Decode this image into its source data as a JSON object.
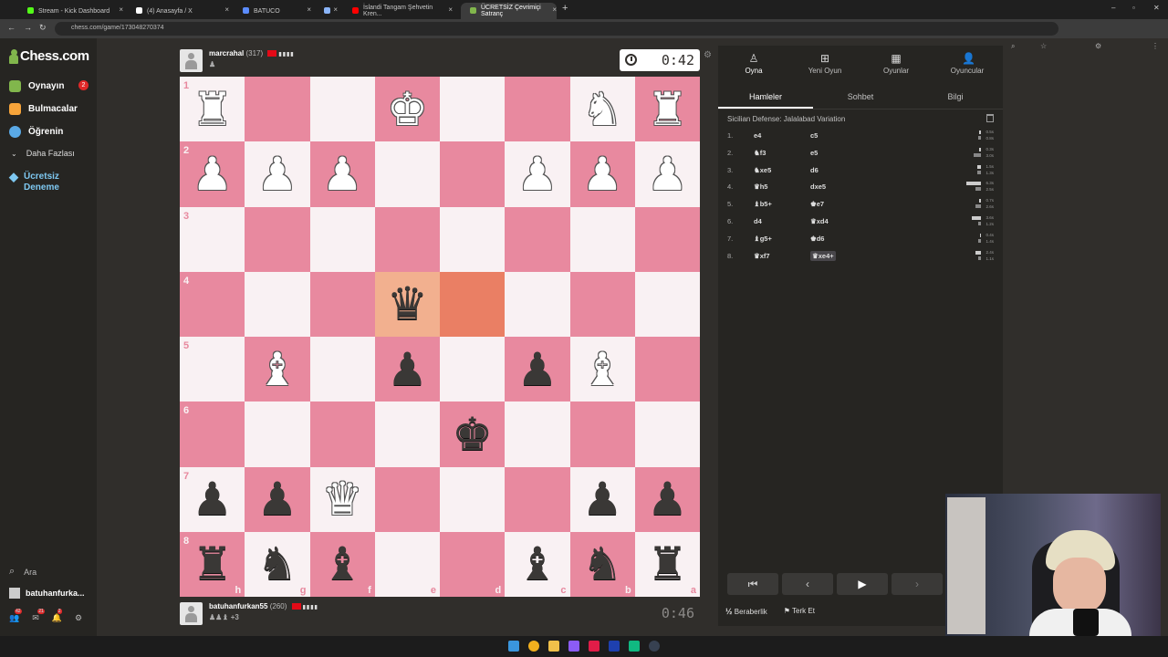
{
  "browser": {
    "tabs": [
      {
        "title": "Stream - Kick Dashboard",
        "fav": "#53fc18"
      },
      {
        "title": "(4) Anasayfa / X",
        "fav": "#ffffff"
      },
      {
        "title": "BATUCO",
        "fav": "#5b8cff"
      },
      {
        "title": "",
        "fav": "#8ab4f8"
      },
      {
        "title": "İslandi Tangam Şehvetin Kren...",
        "fav": "#ff0000"
      },
      {
        "title": "ÜCRETSİZ Çevrimiçi Satranç",
        "fav": "#81b64c"
      }
    ],
    "url": "chess.com/game/173048270374"
  },
  "sidebar": {
    "logo": "Chess.com",
    "items": [
      {
        "label": "Oynayın",
        "badge": "2",
        "color": "#81b64c"
      },
      {
        "label": "Bulmacalar",
        "color": "#f7a43a"
      },
      {
        "label": "Öğrenin",
        "color": "#5aa9e6"
      },
      {
        "label": "Daha Fazlası"
      }
    ],
    "trial": {
      "line1": "Ücretsiz",
      "line2": "Deneme"
    },
    "search": "Ara",
    "user": "batuhanfurka...",
    "notif_counts": [
      "42",
      "21",
      "2"
    ]
  },
  "top_player": {
    "name": "marcrahal",
    "rating": "(317)",
    "clock": "0:42"
  },
  "bottom_player": {
    "name": "batuhanfurkan55",
    "rating": "(260)",
    "clock": "0:46",
    "captured": "+3"
  },
  "board": {
    "ranks": [
      "1",
      "2",
      "3",
      "4",
      "5",
      "6",
      "7",
      "8"
    ],
    "files": [
      "h",
      "g",
      "f",
      "e",
      "d",
      "c",
      "b",
      "a"
    ],
    "rows": [
      [
        "wR",
        "",
        "",
        "wK",
        "",
        "",
        "wN",
        "wR"
      ],
      [
        "wP",
        "wP",
        "wP",
        "",
        "",
        "wP",
        "wP",
        "wP"
      ],
      [
        "",
        "",
        "",
        "",
        "",
        "",
        "",
        ""
      ],
      [
        "",
        "",
        "",
        "bQ",
        "",
        "",
        "",
        ""
      ],
      [
        "",
        "wB",
        "",
        "bP",
        "",
        "bP",
        "wB",
        ""
      ],
      [
        "",
        "",
        "",
        "",
        "bK",
        "",
        "",
        ""
      ],
      [
        "bP",
        "bP",
        "wQ",
        "",
        "",
        "",
        "bP",
        "bP"
      ],
      [
        "bR",
        "bN",
        "bB",
        "",
        "",
        "bB",
        "bN",
        "bR"
      ]
    ],
    "highlight_from": [
      3,
      4
    ],
    "highlight_to": [
      3,
      3
    ]
  },
  "panel": {
    "tabs": [
      {
        "label": "Oyna",
        "icon": "pawn-play-icon"
      },
      {
        "label": "Yeni Oyun",
        "icon": "plus-icon"
      },
      {
        "label": "Oyunlar",
        "icon": "board-icon"
      },
      {
        "label": "Oyuncular",
        "icon": "people-icon"
      }
    ],
    "subtabs": [
      "Hamleler",
      "Sohbet",
      "Bilgi"
    ],
    "opening": "Sicilian Defense: Jalalabad Variation",
    "moves": [
      {
        "n": "1.",
        "w": "e4",
        "b": "c5",
        "t1": "0.5s",
        "t2": "0.8s",
        "w1": 2,
        "w2": 3
      },
      {
        "n": "2.",
        "w": "♞f3",
        "b": "e5",
        "t1": "0.3s",
        "t2": "3.0s",
        "w1": 2,
        "w2": 8
      },
      {
        "n": "3.",
        "w": "♞xe5",
        "b": "d6",
        "t1": "1.5s",
        "t2": "1.3s",
        "w1": 4,
        "w2": 4
      },
      {
        "n": "4.",
        "w": "♛h5",
        "b": "dxe5",
        "t1": "6.3s",
        "t2": "2.5s",
        "w1": 16,
        "w2": 6
      },
      {
        "n": "5.",
        "w": "♝b5+",
        "b": "♚e7",
        "t1": "0.7s",
        "t2": "2.6s",
        "w1": 2,
        "w2": 6
      },
      {
        "n": "6.",
        "w": "d4",
        "b": "♛xd4",
        "t1": "3.6s",
        "t2": "1.2s",
        "w1": 10,
        "w2": 3
      },
      {
        "n": "7.",
        "w": "♝g5+",
        "b": "♚d6",
        "t1": "0.4s",
        "t2": "1.4s",
        "w1": 1,
        "w2": 3
      },
      {
        "n": "8.",
        "w": "♛xf7",
        "b": "♛xe4+",
        "t1": "2.4s",
        "t2": "1.1s",
        "w1": 6,
        "w2": 3
      }
    ],
    "draw": "Beraberlik",
    "resign": "Terk Et"
  }
}
